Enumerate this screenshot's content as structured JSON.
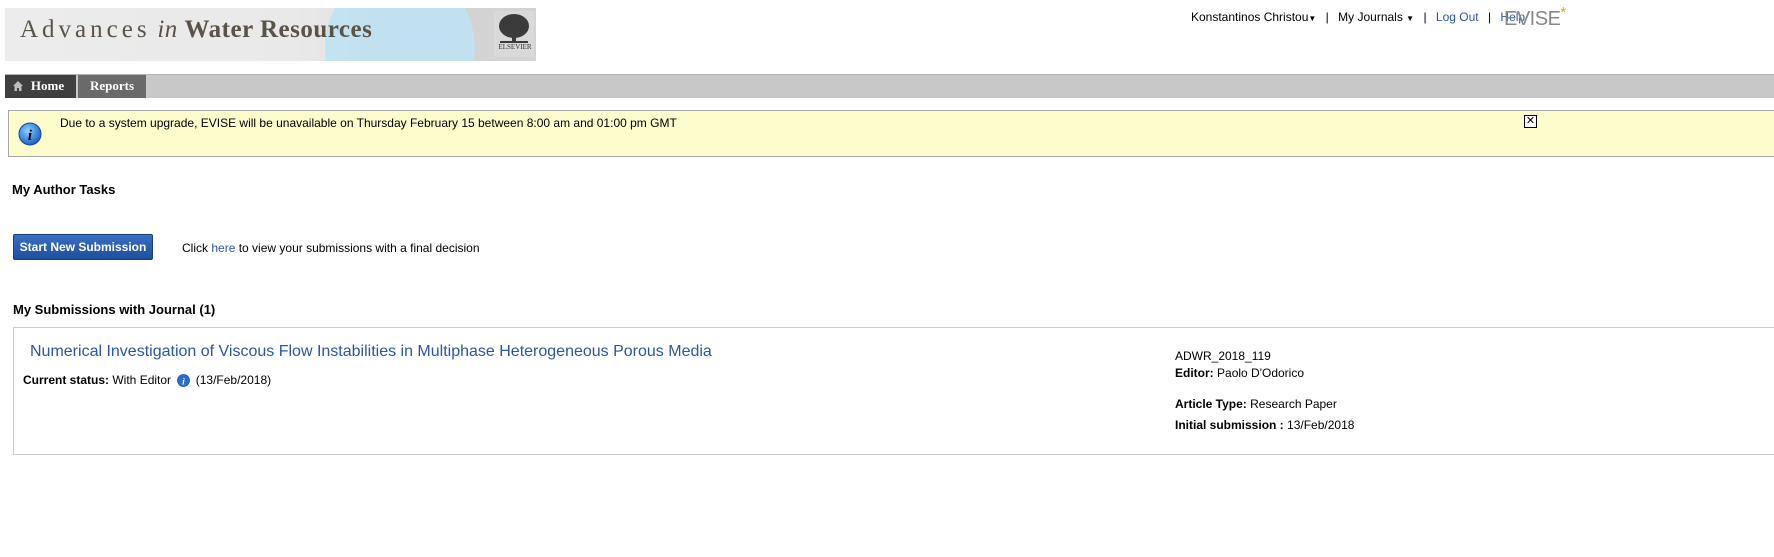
{
  "header": {
    "journal_title_part1": "Advances",
    "journal_title_part2": "in",
    "journal_title_part3": "Water Resources",
    "publisher_logo_text": "ELSEVIER",
    "user_name": "Konstantinos Christou",
    "my_journals_label": "My Journals",
    "logout_label": "Log Out",
    "help_label": "Help",
    "product_name": "EVISE",
    "product_star": "*"
  },
  "nav": {
    "tabs": [
      {
        "label": "Home",
        "active": true
      },
      {
        "label": "Reports",
        "active": false
      }
    ]
  },
  "alert": {
    "message": "Due to a system upgrade, EVISE will be unavailable on Thursday February 15 between 8:00 am and 01:00 pm GMT",
    "close_glyph": "✕"
  },
  "tasks": {
    "heading": "My Author Tasks",
    "start_button": "Start New Submission",
    "final_decision_prefix": "Click",
    "final_decision_link": "here",
    "final_decision_suffix": "to view your submissions with a final decision"
  },
  "submissions": {
    "heading": "My Submissions with Journal (1)",
    "items": [
      {
        "title": "Numerical Investigation of Viscous Flow Instabilities in Multiphase Heterogeneous Porous Media",
        "status_label": "Current status:",
        "status_value": "With Editor",
        "status_date": "(13/Feb/2018)",
        "manuscript_id": "ADWR_2018_119",
        "editor_label": "Editor:",
        "editor_value": "Paolo D'Odorico",
        "article_type_label": "Article Type:",
        "article_type_value": "Research Paper",
        "initial_submission_label": "Initial submission :",
        "initial_submission_value": "13/Feb/2018"
      }
    ]
  },
  "colors": {
    "link": "#2a56a6",
    "alert_bg": "#fdfccd",
    "button": "#2a5db0",
    "nav_active": "#3f3f3f",
    "nav_bar": "#c8c8c8",
    "evise_star": "#e8a21a"
  }
}
